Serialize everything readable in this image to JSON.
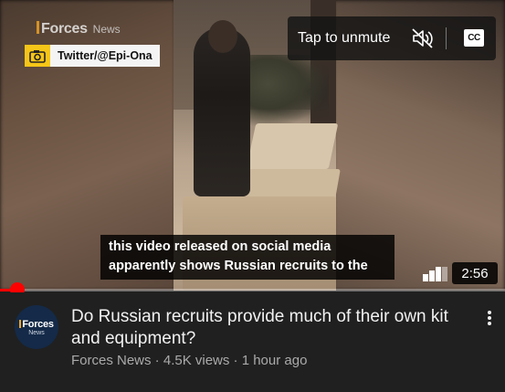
{
  "video": {
    "watermark": {
      "brand": "Forces",
      "sub": "News"
    },
    "source_tag": {
      "icon": "camera-icon",
      "handle": "Twitter/@Epi-Ona"
    },
    "unmute": {
      "label": "Tap to unmute",
      "mute_icon": "muted-speaker-icon",
      "cc_label": "CC"
    },
    "caption_lines": [
      "this video released on social media",
      "apparently shows Russian recruits to the"
    ],
    "duration": "2:56",
    "progress_fraction": 0.035,
    "colors": {
      "progress": "#ff0000",
      "brand_accent": "#f5a623",
      "tag_yellow": "#f5c518"
    }
  },
  "info": {
    "avatar": {
      "line1": "Forces",
      "line2": "News"
    },
    "title": "Do Russian recruits provide much of their own kit and equipment?",
    "meta": "Forces News · 4.5K views · 1 hour ago",
    "menu_icon": "more-vertical-icon"
  }
}
